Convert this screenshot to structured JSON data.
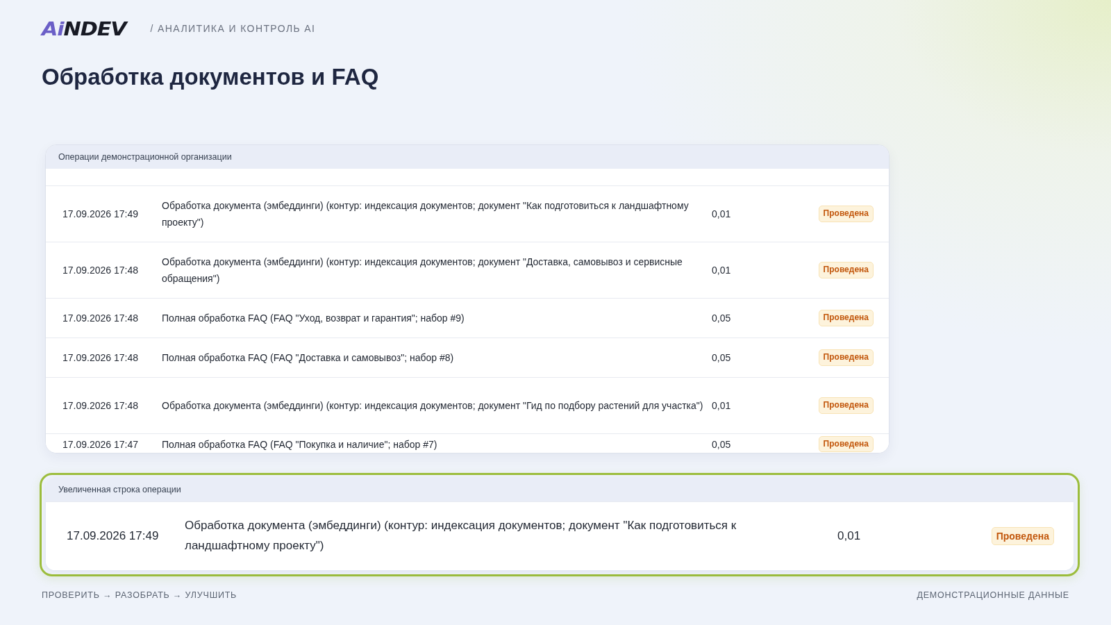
{
  "header": {
    "logo": {
      "accent": "Ai",
      "rest": "NDEV"
    },
    "section": "/ АНАЛИТИКА И КОНТРОЛЬ AI"
  },
  "title": "Обработка документов и FAQ",
  "operations": {
    "title": "Операции демонстрационной организации",
    "rows": [
      {
        "date": "17.09.2026 17:49",
        "description": "Обработка документа (эмбеддинги) (контур: индексация документов; документ \"Как подготовиться к ландшафтному проекту\")",
        "amount": "0,01",
        "status": {
          "label": "Проведена",
          "kind": "done"
        }
      },
      {
        "date": "17.09.2026 17:48",
        "description": "Обработка документа (эмбеддинги) (контур: индексация документов; документ \"Доставка, самовывоз и сервисные обращения\")",
        "amount": "0,01",
        "status": {
          "label": "Проведена",
          "kind": "done"
        }
      },
      {
        "date": "17.09.2026 17:48",
        "description": "Полная обработка FAQ (FAQ \"Уход, возврат и гарантия\"; набор #9)",
        "amount": "0,05",
        "status": {
          "label": "Проведена",
          "kind": "done"
        }
      },
      {
        "date": "17.09.2026 17:48",
        "description": "Полная обработка FAQ (FAQ \"Доставка и самовывоз\"; набор #8)",
        "amount": "0,05",
        "status": {
          "label": "Проведена",
          "kind": "done"
        }
      },
      {
        "date": "17.09.2026 17:48",
        "description": "Обработка документа (эмбеддинги) (контур: индексация документов; документ \"Гид по подбору растений для участка\")",
        "amount": "0,01",
        "status": {
          "label": "Проведена",
          "kind": "done"
        }
      },
      {
        "date": "17.09.2026 17:47",
        "description": "Полная обработка FAQ (FAQ \"Покупка и наличие\"; набор #7)",
        "amount": "0,05",
        "status": {
          "label": "Проведена",
          "kind": "done"
        }
      }
    ]
  },
  "magnified": {
    "title": "Увеличенная строка операции",
    "row": {
      "date": "17.09.2026 17:49",
      "description": "Обработка документа (эмбеддинги) (контур: индексация документов; документ \"Как подготовиться к ландшафтному проекту\")",
      "amount": "0,01",
      "status": {
        "label": "Проведена",
        "kind": "done"
      }
    }
  },
  "footer": {
    "steps": "ПРОВЕРИТЬ → РАЗОБРАТЬ → УЛУЧШИТЬ",
    "note": "ДЕМОНСТРАЦИОННЫЕ ДАННЫЕ"
  }
}
